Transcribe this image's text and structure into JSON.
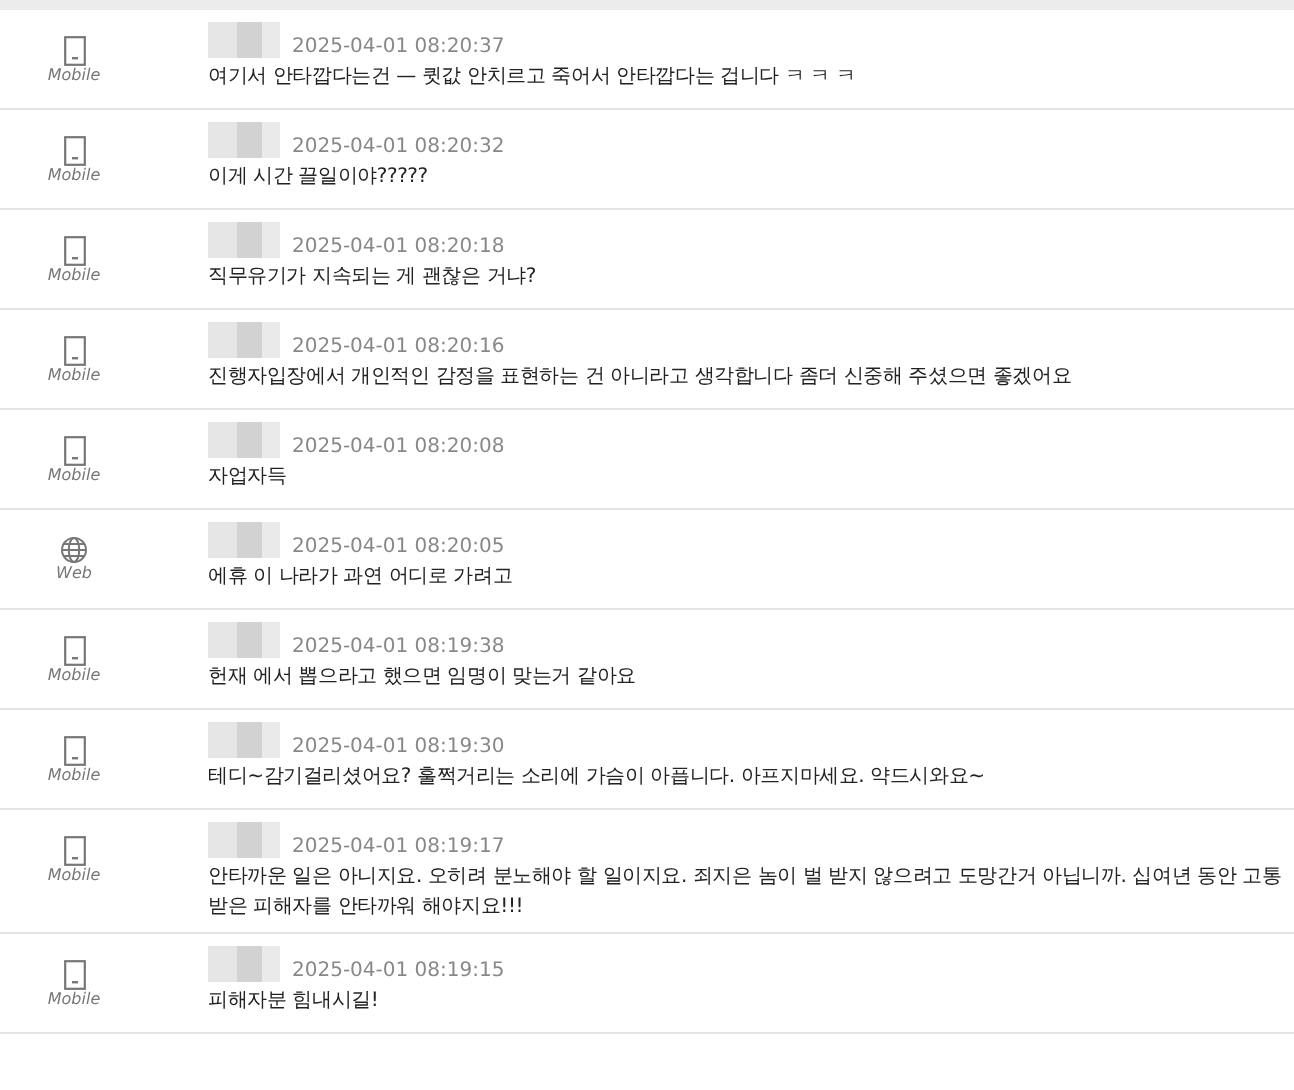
{
  "comments": [
    {
      "kind": "mobile",
      "device_label": "Mobile",
      "time": "2025-04-01 08:20:37",
      "text": "여기서 안타깝다는건 — 큇값 안치르고 죽어서 안타깝다는 겁니다 ㅋ ㅋ ㅋ"
    },
    {
      "kind": "mobile",
      "device_label": "Mobile",
      "time": "2025-04-01 08:20:32",
      "text": "이게 시간 끌일이야?????"
    },
    {
      "kind": "mobile",
      "device_label": "Mobile",
      "time": "2025-04-01 08:20:18",
      "text": "직무유기가 지속되는 게 괜찮은 거냐?"
    },
    {
      "kind": "mobile",
      "device_label": "Mobile",
      "time": "2025-04-01 08:20:16",
      "text": "진행자입장에서 개인적인 감정을 표현하는 건 아니라고 생각합니다 좀더 신중해 주셨으면 좋겠어요"
    },
    {
      "kind": "mobile",
      "device_label": "Mobile",
      "time": "2025-04-01 08:20:08",
      "text": "자업자득"
    },
    {
      "kind": "web",
      "device_label": "Web",
      "time": "2025-04-01 08:20:05",
      "text": "에휴 이 나라가 과연 어디로 가려고"
    },
    {
      "kind": "mobile",
      "device_label": "Mobile",
      "time": "2025-04-01 08:19:38",
      "text": "헌재 에서 뽑으라고 했으면 임명이 맞는거 같아요"
    },
    {
      "kind": "mobile",
      "device_label": "Mobile",
      "time": "2025-04-01 08:19:30",
      "text": "테디~감기걸리셨어요? 훌쩍거리는 소리에 가슴이 아픕니다. 아프지마세요. 약드시와요~"
    },
    {
      "kind": "mobile",
      "device_label": "Mobile",
      "time": "2025-04-01 08:19:17",
      "text": "안타까운 일은 아니지요. 오히려 분노해야 할 일이지요. 죄지은 놈이 벌 받지 않으려고 도망간거 아닙니까. 십여년 동안 고통받은 피해자를 안타까워 해야지요!!!"
    },
    {
      "kind": "mobile",
      "device_label": "Mobile",
      "time": "2025-04-01 08:19:15",
      "text": "피해자분 힘내시길!"
    }
  ]
}
